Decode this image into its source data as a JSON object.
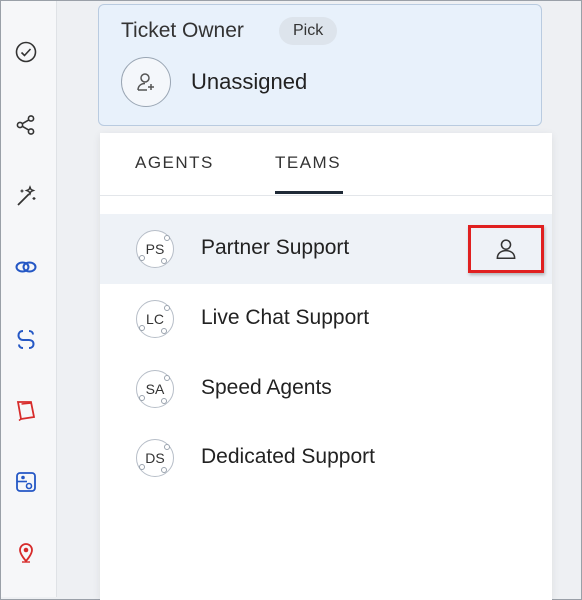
{
  "sidebar": {
    "icons": [
      {
        "name": "check-circle-icon",
        "color": "#333333"
      },
      {
        "name": "share-icon",
        "color": "#333333"
      },
      {
        "name": "magic-wand-icon",
        "color": "#333333"
      },
      {
        "name": "link-icon",
        "color": "#2457c5"
      },
      {
        "name": "zoho-desk-icon",
        "color": "#2457c5"
      },
      {
        "name": "book-icon",
        "color": "#d72b2b"
      },
      {
        "name": "toggle-panel-icon",
        "color": "#2457c5"
      },
      {
        "name": "location-pin-icon",
        "color": "#d72b2b"
      }
    ]
  },
  "owner": {
    "title": "Ticket Owner",
    "pick_label": "Pick",
    "assignee": "Unassigned"
  },
  "tabs": [
    {
      "label": "AGENTS",
      "active": false
    },
    {
      "label": "TEAMS",
      "active": true
    }
  ],
  "teams": [
    {
      "initials": "PS",
      "name": "Partner Support",
      "highlighted": true
    },
    {
      "initials": "LC",
      "name": "Live Chat Support",
      "highlighted": false
    },
    {
      "initials": "SA",
      "name": "Speed Agents",
      "highlighted": false
    },
    {
      "initials": "DS",
      "name": "Dedicated Support",
      "highlighted": false
    }
  ],
  "colors": {
    "highlight_border": "#e02020",
    "card_background": "#e8f1fb"
  }
}
